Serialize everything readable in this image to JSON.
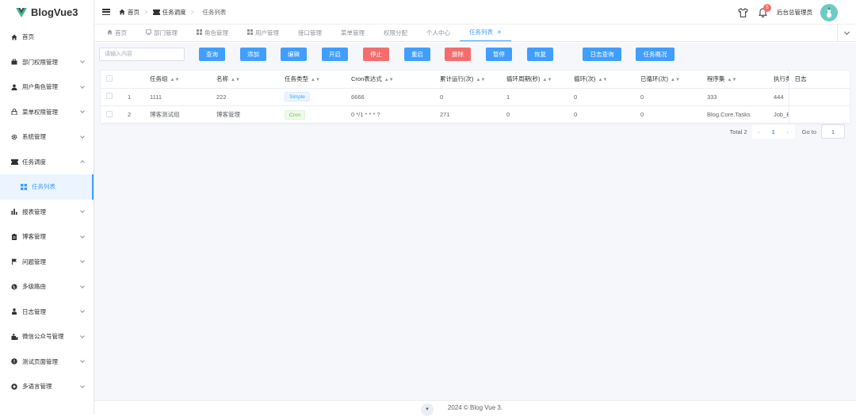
{
  "app": {
    "title": "BlogVue3"
  },
  "sidebar": {
    "items": [
      {
        "label": "首页",
        "icon": "home-icon"
      },
      {
        "label": "部门权限管理",
        "icon": "briefcase-icon"
      },
      {
        "label": "用户角色管理",
        "icon": "user-icon"
      },
      {
        "label": "菜单权限管理",
        "icon": "lock-icon"
      },
      {
        "label": "系统管理",
        "icon": "gear-icon"
      },
      {
        "label": "任务调度",
        "icon": "ticket-icon"
      },
      {
        "label": "任务列表",
        "icon": "grid-icon"
      },
      {
        "label": "报表管理",
        "icon": "bar-chart-icon"
      },
      {
        "label": "博客管理",
        "icon": "clipboard-icon"
      },
      {
        "label": "问题管理",
        "icon": "flag-icon"
      },
      {
        "label": "多级路由",
        "icon": "globe-icon"
      },
      {
        "label": "日志管理",
        "icon": "person-icon"
      },
      {
        "label": "微信公众号管理",
        "icon": "wechat-icon"
      },
      {
        "label": "测试页面管理",
        "icon": "info-icon"
      },
      {
        "label": "多语言管理",
        "icon": "circle-plus-icon"
      }
    ]
  },
  "header": {
    "breadcrumb": [
      "首页",
      "任务调度",
      "任务列表"
    ],
    "user_name": "后台总管理员",
    "notification_count": "5"
  },
  "tabs": [
    "首页",
    "部门管理",
    "角色管理",
    "用户管理",
    "接口管理",
    "菜单管理",
    "权限分配",
    "个人中心",
    "任务列表"
  ],
  "toolbar": {
    "search_placeholder": "请输入内容",
    "buttons": [
      "查询",
      "添加",
      "编辑",
      "开启",
      "停止",
      "重启",
      "删除",
      "暂停",
      "恢复",
      "日志查询",
      "任务概况"
    ]
  },
  "table": {
    "headers": [
      "任务组",
      "名称",
      "任务类型",
      "Cron表达式",
      "累计运行(次)",
      "循环周期(秒)",
      "循环(次)",
      "已循环(次)",
      "程序集",
      "执行类",
      "日志"
    ],
    "rows": [
      {
        "index": "1",
        "group": "1111",
        "name": "222",
        "type": "Simple",
        "cron": "6666",
        "total_runs": "0",
        "cycle_seconds": "1",
        "cycle_times": "0",
        "cycled": "0",
        "assembly": "333",
        "class": "444"
      },
      {
        "index": "2",
        "group": "博客测试组",
        "name": "博客管理",
        "type": "Cron",
        "cron": "0 */1 * * * ?",
        "total_runs": "271",
        "cycle_seconds": "0",
        "cycle_times": "0",
        "cycled": "0",
        "assembly": "Blog.Core.Tasks",
        "class": "Job_Blogs_Qu"
      }
    ]
  },
  "pagination": {
    "total": "Total 2",
    "current": "1",
    "goto_label": "Go to",
    "goto_value": "1"
  },
  "footer": {
    "text": "2024 © Blog Vue 3."
  },
  "colors": {
    "primary": "#409eff",
    "danger": "#f56c6c",
    "success": "#67c23a"
  }
}
